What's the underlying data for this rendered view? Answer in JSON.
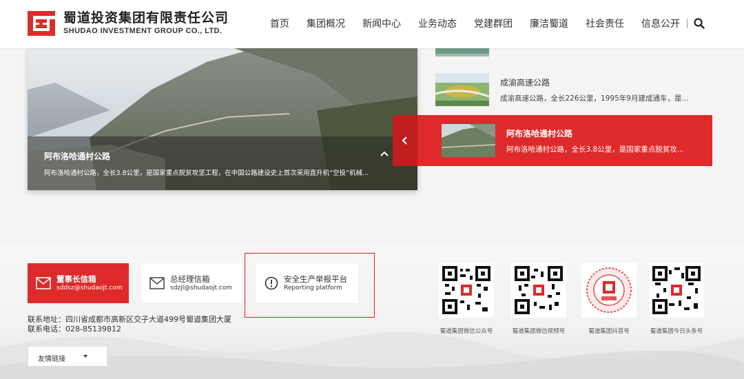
{
  "header": {
    "logo_cn": "蜀道投资集团有限责任公司",
    "logo_en": "SHUDAO INVESTMENT GROUP CO., LTD.",
    "nav": [
      "首页",
      "集团概况",
      "新闻中心",
      "业务动态",
      "党建群团",
      "廉洁蜀道",
      "社会责任",
      "信息公开"
    ]
  },
  "hero": {
    "title": "阿布洛哈通村公路",
    "desc": "阿布洛哈通村公路，全长3.8公里，是国家重点脱贫攻坚工程，在中国公路建设史上首次采用直升机“空投”机械..."
  },
  "news": {
    "items": [
      {
        "title": "成渝高速公路",
        "desc": "成渝高速公路，全长226公里，1995年9月建成通车，是..."
      }
    ],
    "active": {
      "title": "阿布洛哈通村公路",
      "desc": "阿布洛哈通村公路，全长3.8公里，是国家重点脱贫攻..."
    }
  },
  "footer": {
    "mail1": {
      "title": "董事长信箱",
      "sub": "sddsz@shudaojt.com"
    },
    "mail2": {
      "title": "总经理信箱",
      "sub": "sdzjl@shudaojt.com"
    },
    "report": {
      "title": "安全生产举报平台",
      "sub": "Reporting platform"
    },
    "address": "联系地址：四川省成都市高新区交子大道499号蜀道集团大厦",
    "phone": "联系电话：028-85139812",
    "links_label": "友情链接",
    "qrs": [
      "蜀道集团微信公众号",
      "蜀道集团微信视频号",
      "蜀道集团抖音号",
      "蜀道集团今日头条号"
    ]
  },
  "colors": {
    "brand_red": "#de2a2a"
  }
}
